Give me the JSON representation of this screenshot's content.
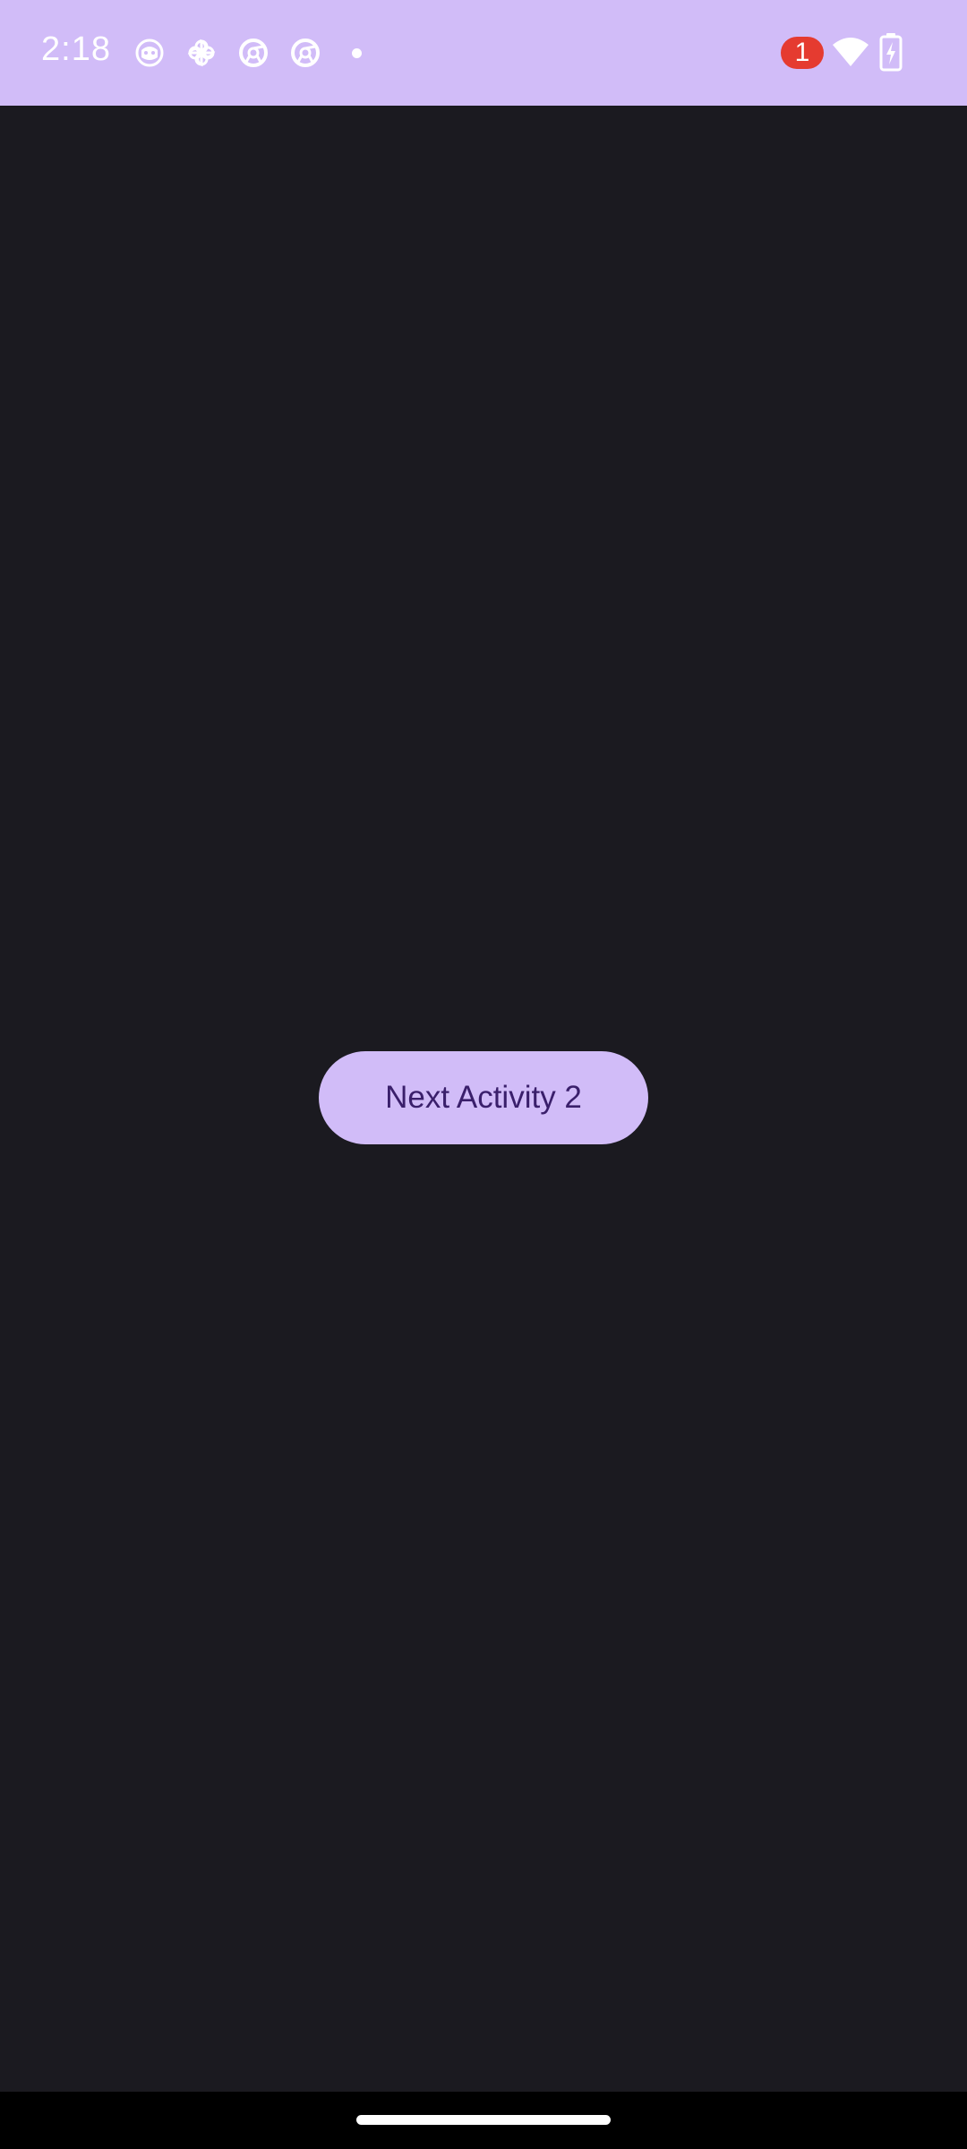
{
  "status_bar": {
    "time": "2:18",
    "notification_icons": [
      "app-notification-icon",
      "pinwheel-icon",
      "chrome-icon",
      "chrome-icon"
    ],
    "notification_count": "1",
    "background_color": "#d1bcf8",
    "badge_color": "#e53b30"
  },
  "main": {
    "button_label": "Next Activity 2",
    "button_color": "#d1bcf8",
    "button_text_color": "#3a1f6b",
    "background_color": "#1b1a20"
  },
  "nav_bar": {
    "style": "gesture-handle"
  }
}
